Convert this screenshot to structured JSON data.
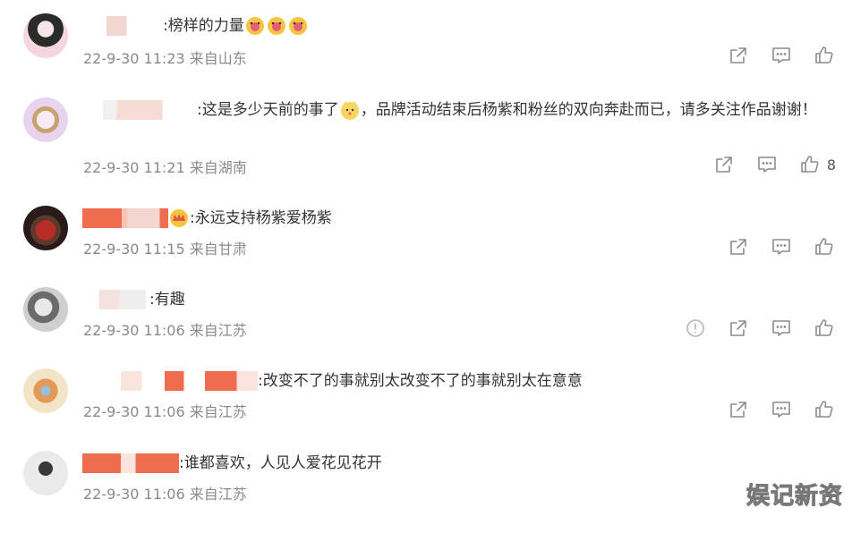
{
  "comments": [
    {
      "text": ":榜样的力量",
      "time": "22-9-30 11:23",
      "location": "来自山东",
      "like_count": "",
      "avatar_colors": [
        "#f4d7dc",
        "#2b2b2b",
        "#f7e6e9"
      ]
    },
    {
      "text": ":这是多少天前的事了",
      "text2": "，品牌活动结束后杨紫和粉丝的双向奔赴而已，请多关注作品谢谢！",
      "time": "22-9-30 11:21",
      "location": "来自湖南",
      "like_count": "8",
      "avatar_colors": [
        "#e9d4f0",
        "#c9a36f",
        "#f6eaf5"
      ]
    },
    {
      "text": ":永远支持杨紫爱杨紫",
      "time": "22-9-30 11:15",
      "location": "来自甘肃",
      "like_count": "",
      "avatar_colors": [
        "#2a1a1a",
        "#b62c26",
        "#5a3a2a"
      ]
    },
    {
      "text": ":有趣",
      "time": "22-9-30 11:06",
      "location": "来自江苏",
      "like_count": "",
      "avatar_colors": [
        "#cfcfcf",
        "#6b6b6b",
        "#e8e8e8"
      ]
    },
    {
      "text": ":改变不了的事就别太改变不了的事就别太在意意",
      "time": "22-9-30 11:06",
      "location": "来自江苏",
      "like_count": "",
      "avatar_colors": [
        "#f3e4c8",
        "#e39a57",
        "#8fc1e0"
      ]
    },
    {
      "text": ":谁都喜欢，人见人爱花见花开",
      "time": "22-9-30 11:06",
      "location": "来自江苏",
      "like_count": "",
      "avatar_colors": [
        "#eaeaea",
        "#3a3a3a",
        "#ffffff"
      ]
    }
  ],
  "icons": {
    "share": "share-icon",
    "comment": "comment-icon",
    "like": "thumbs-up-icon",
    "report": "report-icon"
  },
  "watermark": "娱记新资"
}
